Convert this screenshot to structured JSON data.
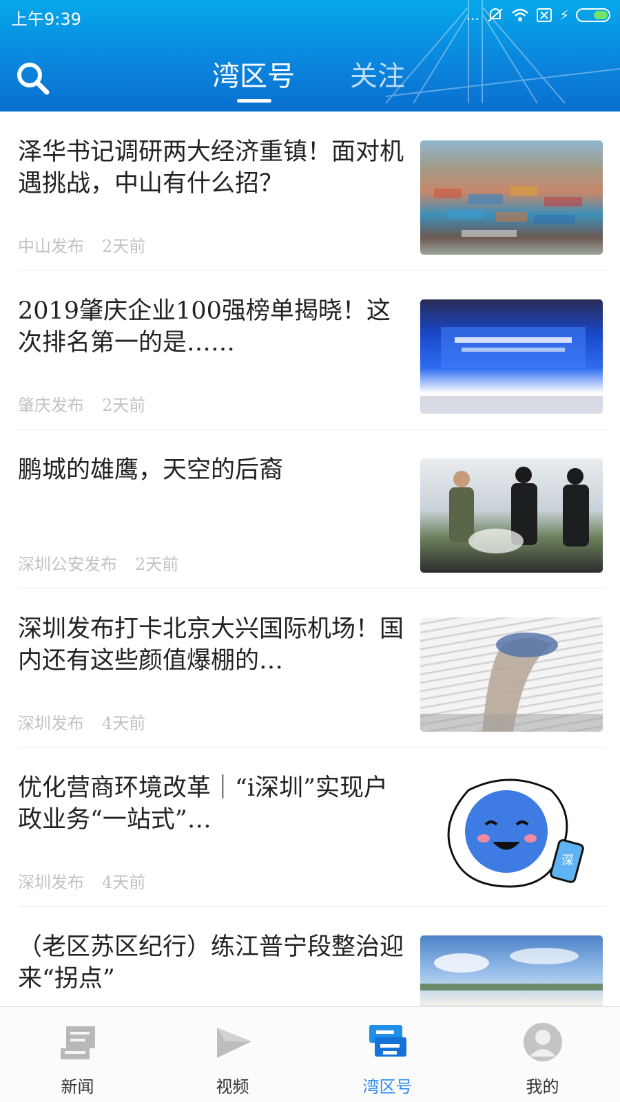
{
  "status_bar": {
    "time": "上午9:39",
    "dots": "...",
    "charge_symbol": "⚡"
  },
  "header": {
    "tabs": [
      {
        "label": "湾区号",
        "active": true
      },
      {
        "label": "关注",
        "active": false
      }
    ]
  },
  "articles": [
    {
      "title": "泽华书记调研两大经济重镇！面对机遇挑战，中山有什么招？",
      "source": "中山发布",
      "time": "2天前",
      "thumb": "port-containers"
    },
    {
      "title": "2019肇庆企业100强榜单揭晓！这次排名第一的是……",
      "source": "肇庆发布",
      "time": "2天前",
      "thumb": "conference-stage"
    },
    {
      "title": "鹏城的雄鹰，天空的后裔",
      "source": "深圳公安发布",
      "time": "2天前",
      "thumb": "police-helicopter"
    },
    {
      "title": "深圳发布打卡北京大兴国际机场！国内还有这些颜值爆棚的…",
      "source": "深圳发布",
      "time": "4天前",
      "thumb": "airport-terminal"
    },
    {
      "title": "优化营商环境改革｜“i深圳”实现户政业务“一站式”…",
      "source": "深圳发布",
      "time": "4天前",
      "thumb": "mascot-phone"
    },
    {
      "title": "（老区苏区纪行）练江普宁段整治迎来“拐点”",
      "source": "",
      "time": "",
      "thumb": "river-landscape"
    }
  ],
  "mascot_phone_glyph": "深",
  "tabbar": {
    "items": [
      {
        "label": "新闻",
        "icon": "newspaper-icon",
        "active": false
      },
      {
        "label": "视频",
        "icon": "play-icon",
        "active": false
      },
      {
        "label": "湾区号",
        "icon": "bay-area-icon",
        "active": true
      },
      {
        "label": "我的",
        "icon": "profile-icon",
        "active": false
      }
    ]
  },
  "colors": {
    "header_blue": "#0b86dd",
    "active_tab": "#2f8df0",
    "meta_gray": "#c2c2c2"
  }
}
